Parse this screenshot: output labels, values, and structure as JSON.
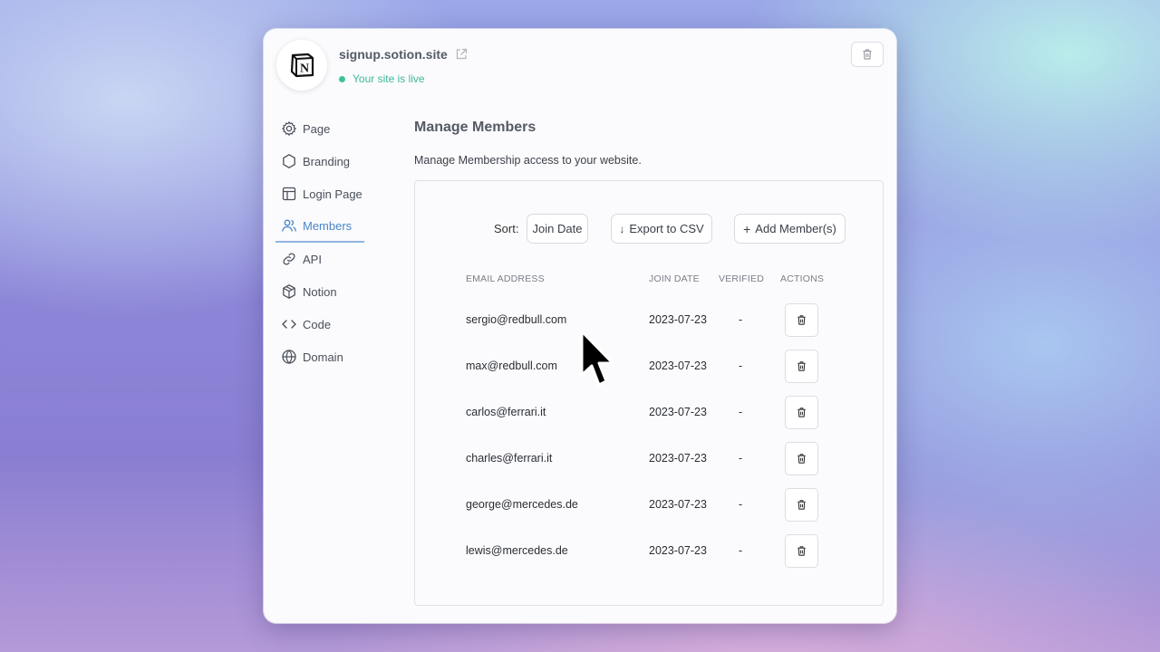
{
  "site": {
    "name": "signup.sotion.site",
    "status": "Your site is live",
    "logo_letter": "N"
  },
  "nav": {
    "items": [
      {
        "label": "Page",
        "icon": "gear-icon"
      },
      {
        "label": "Branding",
        "icon": "hexagon-icon"
      },
      {
        "label": "Login Page",
        "icon": "layout-icon"
      },
      {
        "label": "Members",
        "icon": "users-icon",
        "active": true
      },
      {
        "label": "API",
        "icon": "link-icon"
      },
      {
        "label": "Notion",
        "icon": "cube-icon"
      },
      {
        "label": "Code",
        "icon": "code-icon"
      },
      {
        "label": "Domain",
        "icon": "globe-icon"
      }
    ]
  },
  "main": {
    "title": "Manage Members",
    "subtitle": "Manage Membership access to your website.",
    "sort_label": "Sort:",
    "sort_value": "Join Date",
    "export_label": "Export to CSV",
    "add_label": "Add Member(s)"
  },
  "table": {
    "headers": [
      "EMAIL ADDRESS",
      "JOIN DATE",
      "VERIFIED",
      "ACTIONS"
    ],
    "rows": [
      {
        "email": "sergio@redbull.com",
        "join_date": "2023-07-23",
        "verified": "-"
      },
      {
        "email": "max@redbull.com",
        "join_date": "2023-07-23",
        "verified": "-"
      },
      {
        "email": "carlos@ferrari.it",
        "join_date": "2023-07-23",
        "verified": "-"
      },
      {
        "email": "charles@ferrari.it",
        "join_date": "2023-07-23",
        "verified": "-"
      },
      {
        "email": "george@mercedes.de",
        "join_date": "2023-07-23",
        "verified": "-"
      },
      {
        "email": "lewis@mercedes.de",
        "join_date": "2023-07-23",
        "verified": "-"
      }
    ]
  },
  "colors": {
    "accent": "#4a86c8",
    "live": "#3fb79a"
  }
}
